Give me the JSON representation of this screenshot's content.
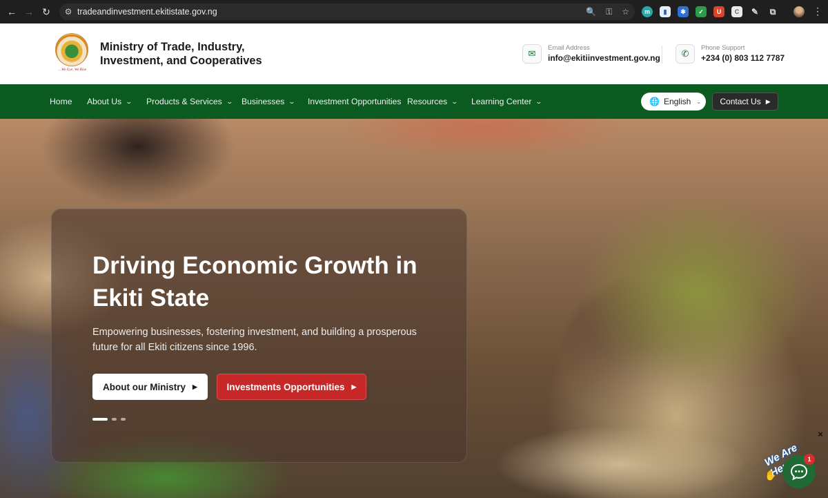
{
  "browser": {
    "url": "tradeandinvestment.ekitistate.gov.ng"
  },
  "header": {
    "org_name": "Ministry of Trade, Industry, Investment, and Cooperatives",
    "seal_motto": "...We Eye, We Rise",
    "email": {
      "label": "Email Address",
      "value": "info@ekitiinvestment.gov.ng"
    },
    "phone": {
      "label": "Phone Support",
      "value": "+234 (0) 803 112 7787"
    }
  },
  "nav": {
    "items": [
      {
        "label": "Home"
      },
      {
        "label": "About Us"
      },
      {
        "label": "Products & Services"
      },
      {
        "label": "Businesses"
      },
      {
        "label": "Investment Opportunities"
      },
      {
        "label": "Resources"
      },
      {
        "label": "Learning Center"
      }
    ],
    "language": "English",
    "contact_button": "Contact Us"
  },
  "hero": {
    "title": "Driving Economic Growth in Ekiti State",
    "subtitle": "Empowering businesses, fostering investment, and building a prosperous future for all Ekiti citizens since 1996.",
    "primary_button": "About our Ministry",
    "secondary_button": "Investments Opportunities",
    "slides_total": 3,
    "slide_active": 1
  },
  "chat": {
    "tagline": "We Are Here!",
    "badge_count": "1",
    "close_label": "×"
  },
  "colors": {
    "nav_green": "#0b5a1f",
    "accent_red": "#c62828",
    "chat_green": "#1f6a35"
  }
}
